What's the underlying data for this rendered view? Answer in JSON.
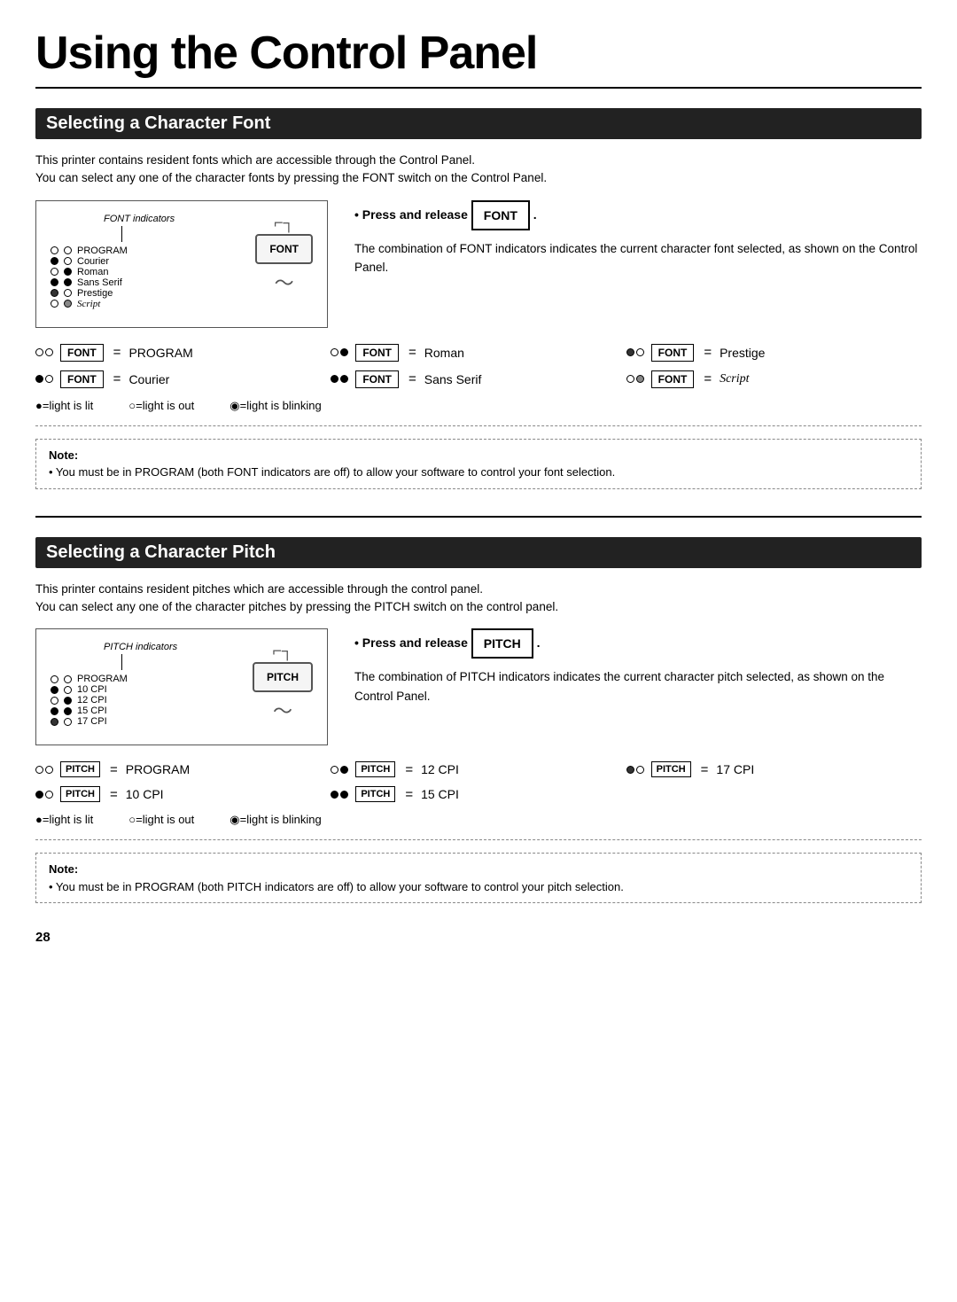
{
  "page": {
    "title": "Using the Control Panel",
    "page_number": "28"
  },
  "font_section": {
    "heading": "Selecting a Character Font",
    "intro_line1": "This printer contains resident fonts which are accessible through the Control Panel.",
    "intro_line2": "You can select any one of the character fonts by pressing the FONT switch on the Control Panel.",
    "panel_title": "FONT indicators",
    "panel_indicators": [
      {
        "dot1": "empty",
        "dot2": "empty",
        "label": "PROGRAM"
      },
      {
        "dot1": "filled",
        "dot2": "empty",
        "label": "Courier"
      },
      {
        "dot1": "empty",
        "dot2": "filled",
        "label": "Roman"
      },
      {
        "dot1": "filled",
        "dot2": "filled",
        "label": "Sans Serif"
      },
      {
        "dot1": "filled_dark",
        "dot2": "empty",
        "label": "Prestige"
      },
      {
        "dot1": "empty",
        "dot2": "half",
        "label": "Script"
      }
    ],
    "switch_label": "FONT",
    "press_instruction": "• Press and release",
    "press_button": "FONT",
    "combo_description": "The combination of FONT indicators indicates the current character font selected, as shown on the Control Panel.",
    "combinations": [
      {
        "dot1": "empty",
        "dot2": "empty",
        "btn": "FONT",
        "eq": "=",
        "name": "PROGRAM",
        "italic": false
      },
      {
        "dot1": "empty",
        "dot2": "filled",
        "btn": "FONT",
        "eq": "=",
        "name": "Roman",
        "italic": false
      },
      {
        "dot1": "filled_dark",
        "dot2": "empty",
        "btn": "FONT",
        "eq": "=",
        "name": "Prestige",
        "italic": false
      },
      {
        "dot1": "filled",
        "dot2": "empty",
        "btn": "FONT",
        "eq": "=",
        "name": "Courier",
        "italic": false
      },
      {
        "dot1": "filled",
        "dot2": "filled",
        "btn": "FONT",
        "eq": "=",
        "name": "Sans Serif",
        "italic": false
      },
      {
        "dot1": "empty",
        "dot2": "half",
        "btn": "FONT",
        "eq": "=",
        "name": "Script",
        "italic": true
      }
    ],
    "legend": [
      "●=light is lit",
      "○=light is out",
      "◉=light is blinking"
    ],
    "note_label": "Note:",
    "note_text": "• You must be in PROGRAM (both FONT indicators are off) to allow your software to control your font selection."
  },
  "pitch_section": {
    "heading": "Selecting a Character Pitch",
    "intro_line1": "This printer contains resident pitches which are accessible through the control panel.",
    "intro_line2": "You can select any one of the character pitches by pressing the PITCH switch on the control panel.",
    "panel_title": "PITCH indicators",
    "panel_indicators": [
      {
        "dot1": "empty",
        "dot2": "empty",
        "label": "PROGRAM"
      },
      {
        "dot1": "filled",
        "dot2": "empty",
        "label": "10 CPI"
      },
      {
        "dot1": "empty",
        "dot2": "filled",
        "label": "12 CPI"
      },
      {
        "dot1": "filled",
        "dot2": "filled",
        "label": "15 CPI"
      },
      {
        "dot1": "filled_dark",
        "dot2": "empty",
        "label": "17 CPI"
      }
    ],
    "switch_label": "PITCH",
    "press_instruction": "• Press and release",
    "press_button": "PITCH",
    "combo_description": "The combination of PITCH indicators indicates the current character pitch selected, as shown on the Control Panel.",
    "combinations": [
      {
        "dot1": "empty",
        "dot2": "empty",
        "btn": "PITCH",
        "eq": "=",
        "name": "PROGRAM"
      },
      {
        "dot1": "empty",
        "dot2": "filled",
        "btn": "PITCH",
        "eq": "=",
        "name": "12 CPI"
      },
      {
        "dot1": "filled_dark",
        "dot2": "empty",
        "btn": "PITCH",
        "eq": "=",
        "name": "17 CPI"
      },
      {
        "dot1": "filled",
        "dot2": "empty",
        "btn": "PITCH",
        "eq": "=",
        "name": "10 CPI"
      },
      {
        "dot1": "filled",
        "dot2": "filled",
        "btn": "PITCH",
        "eq": "=",
        "name": "15 CPI"
      }
    ],
    "legend": [
      "●=light is lit",
      "○=light is out",
      "◉=light is blinking"
    ],
    "note_label": "Note:",
    "note_text": "• You must be in PROGRAM (both PITCH indicators are off) to allow your software to control your pitch selection."
  }
}
